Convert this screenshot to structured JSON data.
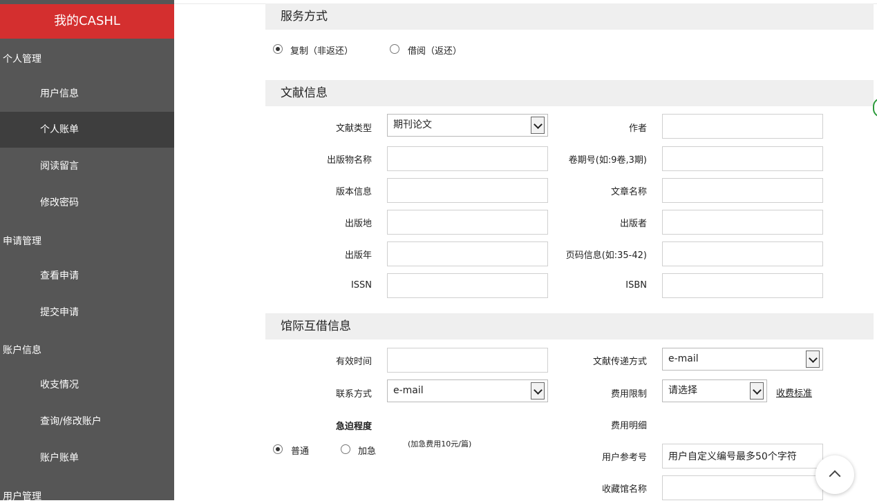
{
  "sidebar": {
    "brand": "我的CASHL",
    "groups": [
      {
        "label": "个人管理",
        "items": [
          "用户信息",
          "个人账单",
          "阅读留言",
          "修改密码"
        ]
      },
      {
        "label": "申请管理",
        "items": [
          "查看申请",
          "提交申请"
        ]
      },
      {
        "label": "账户信息",
        "items": [
          "收支情况",
          "查询/修改账户",
          "账户账单"
        ]
      },
      {
        "label": "用户管理",
        "items": []
      }
    ],
    "active_item": "个人账单"
  },
  "service": {
    "header": "服务方式",
    "options": [
      {
        "label": "复制（非返还）",
        "checked": true
      },
      {
        "label": "借阅（返还）",
        "checked": false
      }
    ]
  },
  "document": {
    "header": "文献信息",
    "doc_type_label": "文献类型",
    "doc_type_value": "期刊论文",
    "author_label": "作者",
    "pub_name_label": "出版物名称",
    "volume_label": "卷期号(如:9卷,3期)",
    "edition_label": "版本信息",
    "article_label": "文章名称",
    "place_label": "出版地",
    "publisher_label": "出版者",
    "year_label": "出版年",
    "pages_label": "页码信息(如:35-42)",
    "issn_label": "ISSN",
    "isbn_label": "ISBN"
  },
  "ill": {
    "header": "馆际互借信息",
    "valid_time_label": "有效时间",
    "delivery_label": "文献传递方式",
    "delivery_value": "e-mail",
    "contact_label": "联系方式",
    "contact_value": "e-mail",
    "fee_limit_label": "费用限制",
    "fee_limit_value": "请选择",
    "fee_standard_link": "收费标准",
    "urgency_label": "急迫程度",
    "fee_detail_label": "费用明细",
    "urgency_options": [
      {
        "label": "普通",
        "checked": true
      },
      {
        "label": "加急",
        "checked": false
      }
    ],
    "urgent_note": "(加急费用10元/篇)",
    "user_ref_label": "用户参考号",
    "user_ref_value": "用户自定义编号最多50个字符",
    "library_label": "收藏馆名称"
  }
}
